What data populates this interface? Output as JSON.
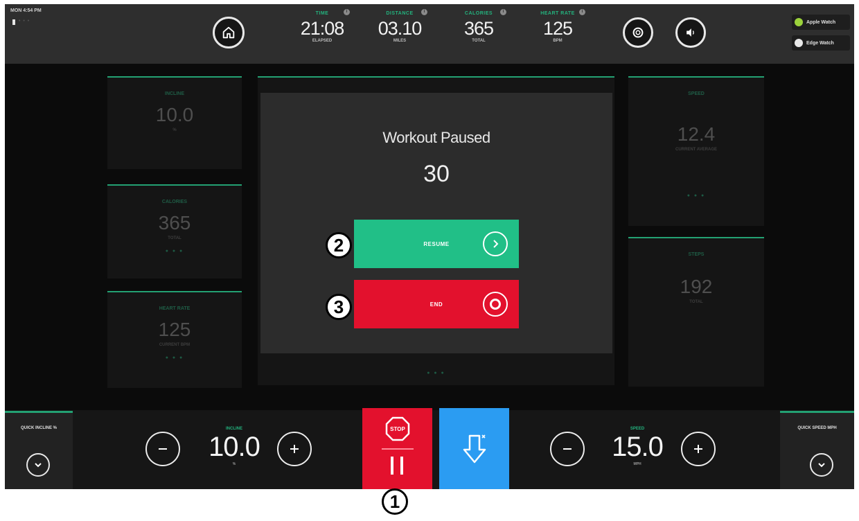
{
  "status": {
    "clock": "MON 4:54 PM",
    "battery_dots": "• • •"
  },
  "metrics": [
    {
      "label": "TIME",
      "value": "21:08",
      "unit": "ELAPSED"
    },
    {
      "label": "DISTANCE",
      "value": "03.10",
      "unit": "MILES"
    },
    {
      "label": "CALORIES",
      "value": "365",
      "unit": "TOTAL"
    },
    {
      "label": "HEART RATE",
      "value": "125",
      "unit": "BPM"
    }
  ],
  "metric_info_glyph": "i",
  "watch_badges": {
    "apple": "Apple Watch",
    "edge": "Edge Watch"
  },
  "left_tiles": {
    "incline": {
      "label": "INCLINE",
      "value": "10.0",
      "unit": "%",
      "dots": ""
    },
    "calories": {
      "label": "CALORIES",
      "value": "365",
      "unit": "TOTAL",
      "dots": "● ● ●"
    },
    "heart_rate": {
      "label": "HEART RATE",
      "value": "125",
      "unit": "CURRENT BPM",
      "dots": "● ● ●"
    }
  },
  "right_tiles": {
    "speed": {
      "label": "SPEED",
      "value": "12.4",
      "unit": "CURRENT AVERAGE",
      "dots": "● ● ●"
    },
    "steps": {
      "label": "STEPS",
      "value": "192",
      "unit": "TOTAL"
    }
  },
  "center_dots": "● ● ●",
  "modal": {
    "title": "Workout Paused",
    "countdown": "30",
    "resume_label": "RESUME",
    "end_label": "END"
  },
  "controls": {
    "quick_incline_label": "QUICK INCLINE %",
    "quick_speed_label": "QUICK SPEED MPH",
    "incline": {
      "label": "INCLINE",
      "value": "10.0",
      "unit": "%"
    },
    "speed": {
      "label": "SPEED",
      "value": "15.0",
      "unit": "MPH"
    },
    "stop_text": "STOP"
  },
  "callouts": [
    "1",
    "2",
    "3"
  ],
  "colors": {
    "accent_green": "#23b37e",
    "resume_green": "#21bf87",
    "stop_red": "#e3112d",
    "cooldown_blue": "#2b9cf2"
  },
  "icons": {
    "home": "home-icon",
    "settings": "gear-icon",
    "sound": "speaker-icon",
    "resume": "chevron-right-icon",
    "end": "stop-circle-icon",
    "quick": "chevron-down-icon",
    "cooldown": "arrow-down-icon",
    "stop": "stop-sign-icon"
  }
}
